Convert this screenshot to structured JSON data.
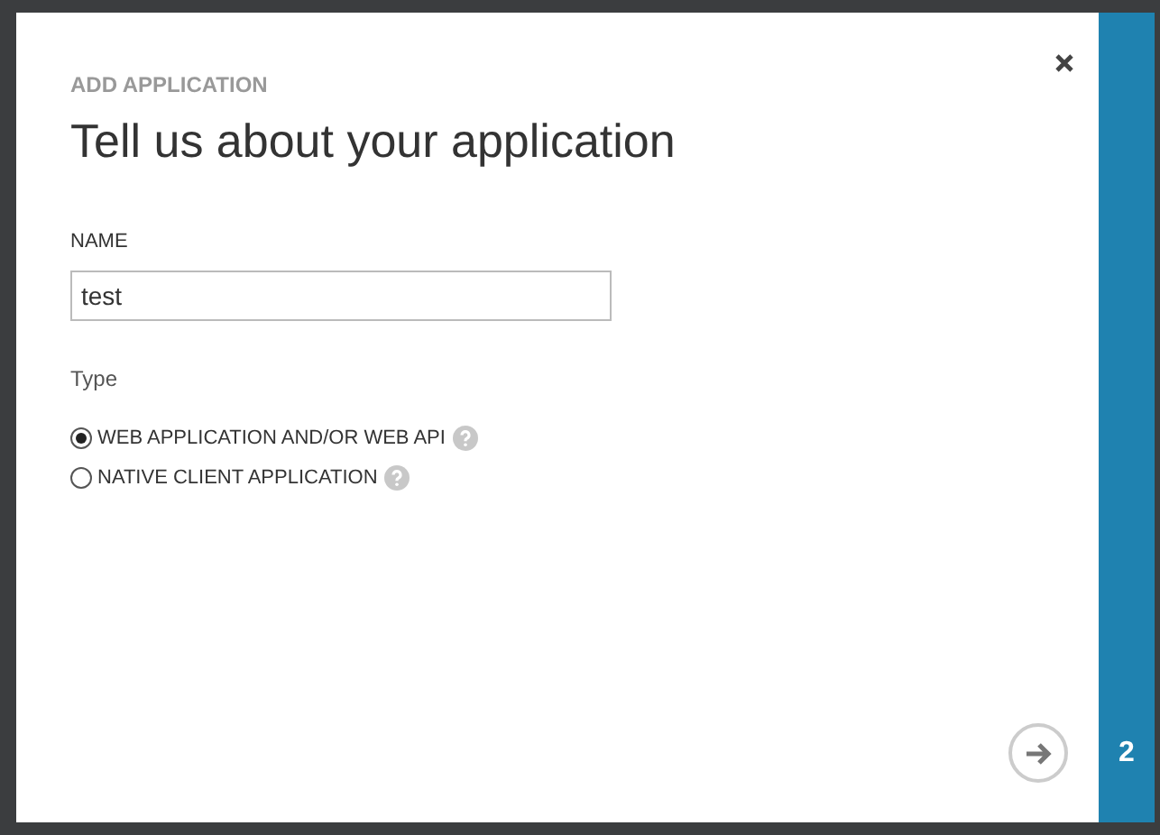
{
  "dialog": {
    "subtitle": "ADD APPLICATION",
    "title": "Tell us about your application",
    "name_label": "NAME",
    "name_value": "test",
    "type_label": "Type",
    "types": [
      {
        "label": "WEB APPLICATION AND/OR WEB API",
        "selected": true
      },
      {
        "label": "NATIVE CLIENT APPLICATION",
        "selected": false
      }
    ],
    "step": "2"
  }
}
